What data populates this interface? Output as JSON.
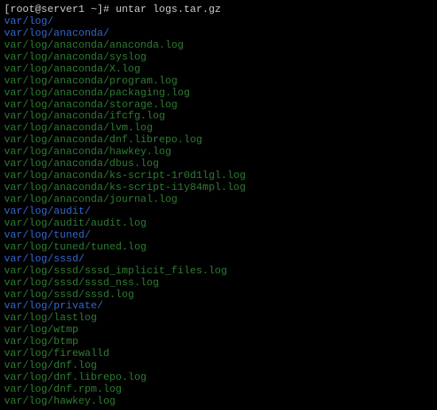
{
  "prompt": {
    "user_host": "[root@server1 ~]#",
    "command": "untar logs.tar.gz"
  },
  "output": [
    {
      "text": "var/log/",
      "type": "dir"
    },
    {
      "text": "var/log/anaconda/",
      "type": "dir"
    },
    {
      "text": "var/log/anaconda/anaconda.log",
      "type": "file"
    },
    {
      "text": "var/log/anaconda/syslog",
      "type": "file"
    },
    {
      "text": "var/log/anaconda/X.log",
      "type": "file"
    },
    {
      "text": "var/log/anaconda/program.log",
      "type": "file"
    },
    {
      "text": "var/log/anaconda/packaging.log",
      "type": "file"
    },
    {
      "text": "var/log/anaconda/storage.log",
      "type": "file"
    },
    {
      "text": "var/log/anaconda/ifcfg.log",
      "type": "file"
    },
    {
      "text": "var/log/anaconda/lvm.log",
      "type": "file"
    },
    {
      "text": "var/log/anaconda/dnf.librepo.log",
      "type": "file"
    },
    {
      "text": "var/log/anaconda/hawkey.log",
      "type": "file"
    },
    {
      "text": "var/log/anaconda/dbus.log",
      "type": "file"
    },
    {
      "text": "var/log/anaconda/ks-script-1r0d1lgl.log",
      "type": "file"
    },
    {
      "text": "var/log/anaconda/ks-script-i1y84mpl.log",
      "type": "file"
    },
    {
      "text": "var/log/anaconda/journal.log",
      "type": "file"
    },
    {
      "text": "var/log/audit/",
      "type": "dir"
    },
    {
      "text": "var/log/audit/audit.log",
      "type": "file"
    },
    {
      "text": "var/log/tuned/",
      "type": "dir"
    },
    {
      "text": "var/log/tuned/tuned.log",
      "type": "file"
    },
    {
      "text": "var/log/sssd/",
      "type": "dir"
    },
    {
      "text": "var/log/sssd/sssd_implicit_files.log",
      "type": "file"
    },
    {
      "text": "var/log/sssd/sssd_nss.log",
      "type": "file"
    },
    {
      "text": "var/log/sssd/sssd.log",
      "type": "file"
    },
    {
      "text": "var/log/private/",
      "type": "dir"
    },
    {
      "text": "var/log/lastlog",
      "type": "file"
    },
    {
      "text": "var/log/wtmp",
      "type": "file"
    },
    {
      "text": "var/log/btmp",
      "type": "file"
    },
    {
      "text": "var/log/firewalld",
      "type": "file"
    },
    {
      "text": "var/log/dnf.log",
      "type": "file"
    },
    {
      "text": "var/log/dnf.librepo.log",
      "type": "file"
    },
    {
      "text": "var/log/dnf.rpm.log",
      "type": "file"
    },
    {
      "text": "var/log/hawkey.log",
      "type": "file"
    }
  ]
}
